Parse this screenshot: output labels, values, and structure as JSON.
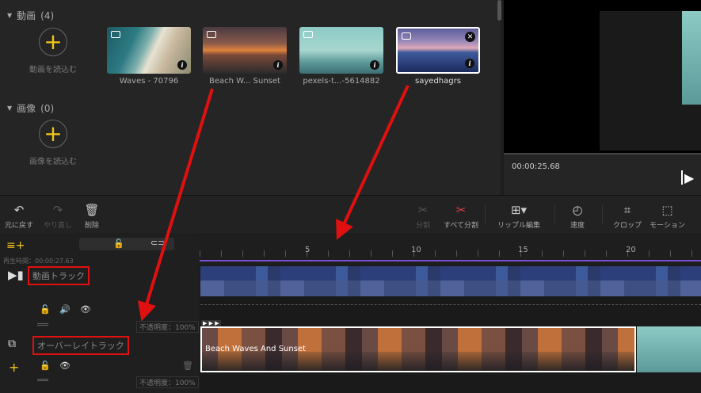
{
  "media": {
    "video_section": {
      "title": "動画",
      "count": "(4)"
    },
    "image_section": {
      "title": "画像",
      "count": "(0)"
    },
    "import_video_label": "動画を読込む",
    "import_image_label": "画像を読込む",
    "clips": [
      {
        "label": "Waves - 70796"
      },
      {
        "label": "Beach W... Sunset"
      },
      {
        "label": "pexels-t...-5614882"
      },
      {
        "label": "sayedhagrs"
      }
    ]
  },
  "preview": {
    "timecode": "00:00:25.68"
  },
  "toolbar": {
    "undo": "元に戻す",
    "redo": "やり直し",
    "delete": "削除",
    "split": "分割",
    "split_all": "すべて分割",
    "ripple_edit": "リップル編集",
    "speed": "速度",
    "crop": "クロップ",
    "motion": "モーション"
  },
  "timeline": {
    "playtime": "再生時間：00:00:27.63",
    "ticks": [
      "5",
      "10",
      "15",
      "20"
    ],
    "video_track_label": "動画トラック",
    "overlay_track_label": "オーバーレイトラック",
    "opacity_label": "不透明度：100%",
    "overlay_clip_title": "Beach Waves And Sunset"
  },
  "colors": {
    "accent": "#f5c518",
    "annotation": "#e01010",
    "playhead": "#7b4fd6"
  }
}
